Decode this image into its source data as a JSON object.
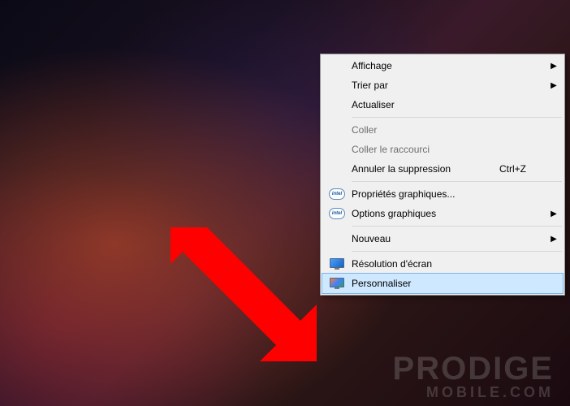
{
  "context_menu": {
    "items": [
      {
        "label": "Affichage",
        "submenu": true
      },
      {
        "label": "Trier par",
        "submenu": true
      },
      {
        "label": "Actualiser"
      }
    ],
    "items2": [
      {
        "label": "Coller",
        "disabled": true
      },
      {
        "label": "Coller le raccourci",
        "disabled": true
      },
      {
        "label": "Annuler la suppression",
        "shortcut": "Ctrl+Z"
      }
    ],
    "items3": [
      {
        "label": "Propriétés graphiques...",
        "icon": "intel"
      },
      {
        "label": "Options graphiques",
        "icon": "intel",
        "submenu": true
      }
    ],
    "items4": [
      {
        "label": "Nouveau",
        "submenu": true
      }
    ],
    "items5": [
      {
        "label": "Résolution d'écran",
        "icon": "monitor-display"
      },
      {
        "label": "Personnaliser",
        "icon": "monitor-personalize",
        "highlighted": true
      }
    ]
  },
  "watermark": {
    "line1": "PRODIGE",
    "line2": "MOBILE.COM"
  }
}
